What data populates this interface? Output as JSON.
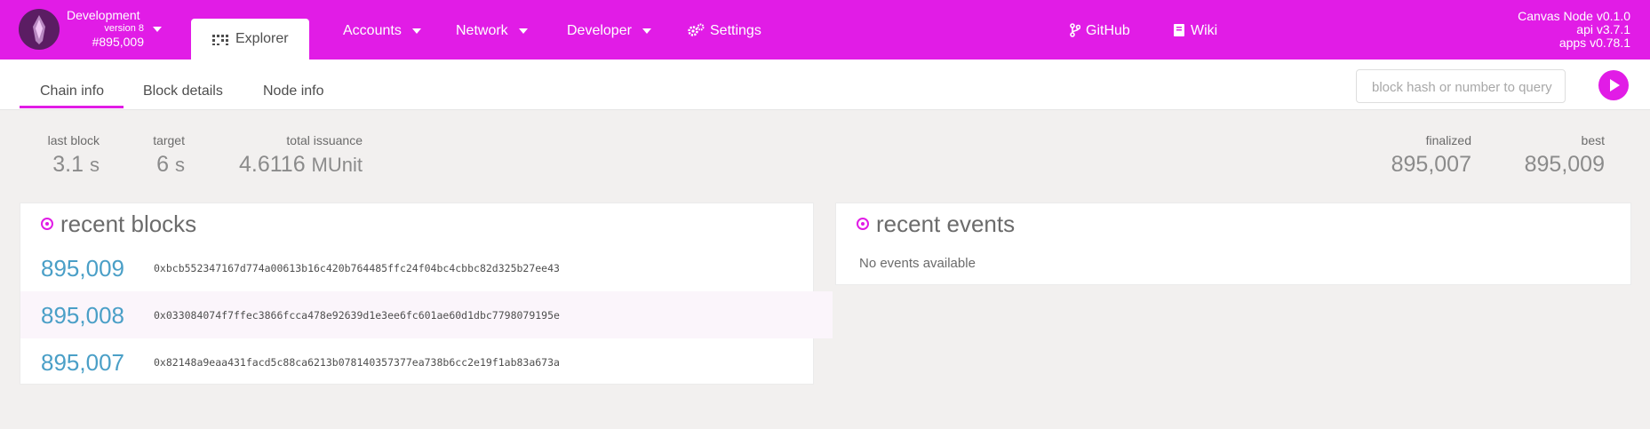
{
  "chain": {
    "name": "Development",
    "version": "version 8",
    "block": "#895,009"
  },
  "nav": {
    "explorer": "Explorer",
    "accounts": "Accounts",
    "network": "Network",
    "developer": "Developer",
    "settings": "Settings",
    "github": "GitHub",
    "wiki": "Wiki"
  },
  "versions": {
    "node": "Canvas Node v0.1.0",
    "api": "api v3.7.1",
    "apps": "apps v0.78.1"
  },
  "tabs": [
    "Chain info",
    "Block details",
    "Node info"
  ],
  "search": {
    "placeholder": "block hash or number to query"
  },
  "stats": {
    "last_block": {
      "label": "last block",
      "value": "3.1",
      "unit": "s"
    },
    "target": {
      "label": "target",
      "value": "6",
      "unit": "s"
    },
    "total_issuance": {
      "label": "total issuance",
      "value": "4.6116",
      "unit": "MUnit"
    },
    "finalized": {
      "label": "finalized",
      "value": "895,007"
    },
    "best": {
      "label": "best",
      "value": "895,009"
    }
  },
  "recent_blocks": {
    "title": "recent blocks",
    "rows": [
      {
        "number": "895,009",
        "hash": "0xbcb552347167d774a00613b16c420b764485ffc24f04bc4cbbc82d325b27ee43"
      },
      {
        "number": "895,008",
        "hash": "0x033084074f7ffec3866fcca478e92639d1e3ee6fc601ae60d1dbc7798079195e"
      },
      {
        "number": "895,007",
        "hash": "0x82148a9eaa431facd5c88ca6213b078140357377ea738b6cc2e19f1ab83a673a"
      }
    ]
  },
  "recent_events": {
    "title": "recent events",
    "empty": "No events available"
  },
  "colors": {
    "accent": "#e11ce6",
    "link": "#4a9fc7"
  }
}
